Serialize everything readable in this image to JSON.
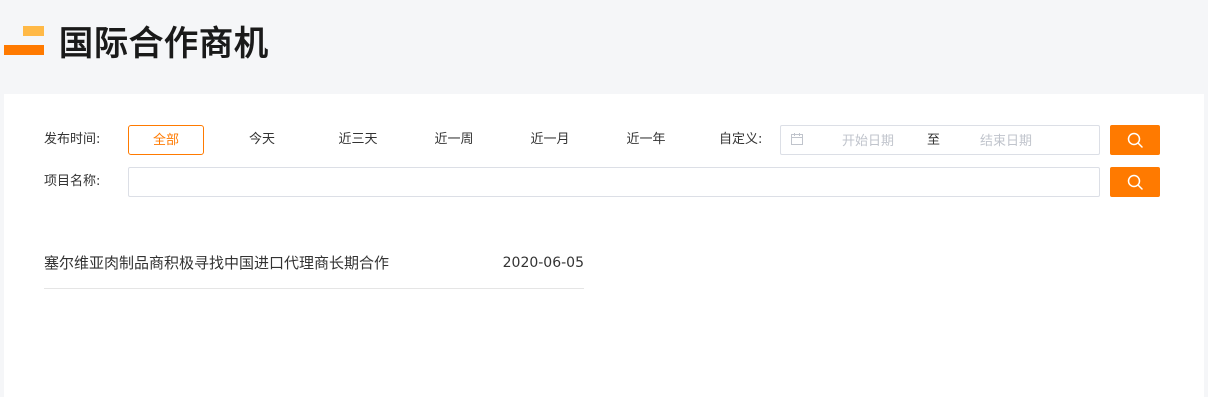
{
  "header": {
    "title": "国际合作商机"
  },
  "filters": {
    "publish_time_label": "发布时间:",
    "time_options": [
      {
        "label": "全部",
        "active": true
      },
      {
        "label": "今天",
        "active": false
      },
      {
        "label": "近三天",
        "active": false
      },
      {
        "label": "近一周",
        "active": false
      },
      {
        "label": "近一月",
        "active": false
      },
      {
        "label": "近一年",
        "active": false
      }
    ],
    "custom_label": "自定义:",
    "start_date_placeholder": "开始日期",
    "date_separator": "至",
    "end_date_placeholder": "结束日期",
    "project_name_label": "项目名称:",
    "project_name_value": ""
  },
  "results": [
    {
      "title": "塞尔维亚肉制品商积极寻找中国进口代理商长期合作",
      "date": "2020-06-05"
    }
  ],
  "colors": {
    "accent": "#ff7a00",
    "accent_light": "#ffb947"
  }
}
